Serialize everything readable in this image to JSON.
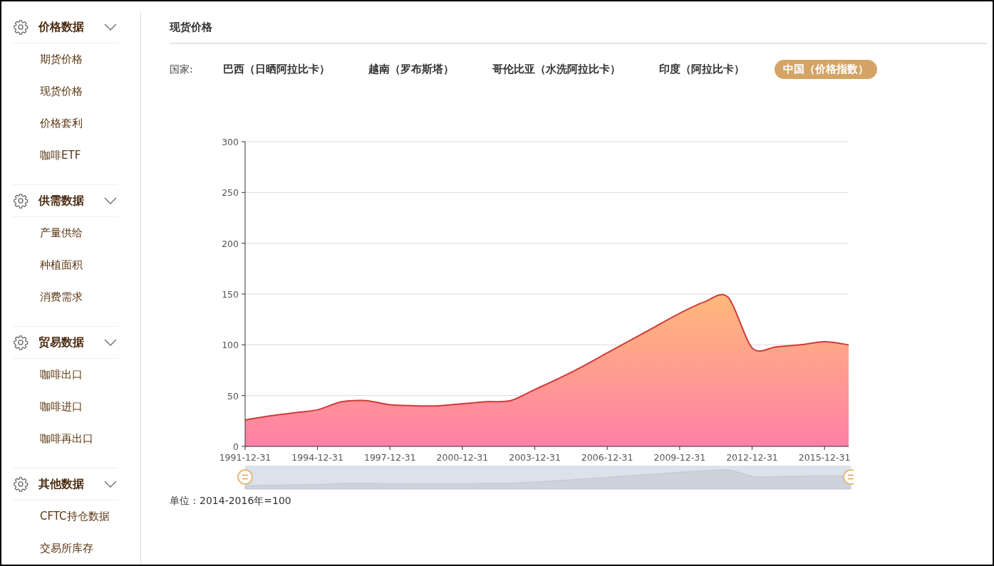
{
  "sidebar": {
    "sections": [
      {
        "title": "价格数据",
        "items": [
          "期货价格",
          "现货价格",
          "价格套利",
          "咖啡ETF"
        ]
      },
      {
        "title": "供需数据",
        "items": [
          "产量供给",
          "种植面积",
          "消费需求"
        ]
      },
      {
        "title": "贸易数据",
        "items": [
          "咖啡出口",
          "咖啡进口",
          "咖啡再出口"
        ]
      },
      {
        "title": "其他数据",
        "items": [
          "CFTC持仓数据",
          "交易所库存"
        ]
      }
    ]
  },
  "main": {
    "title": "现货价格",
    "country_label": "国家:",
    "countries": [
      {
        "label": "巴西（日晒阿拉比卡）",
        "selected": false
      },
      {
        "label": "越南（罗布斯塔）",
        "selected": false
      },
      {
        "label": "哥伦比亚（水洗阿拉比卡）",
        "selected": false
      },
      {
        "label": "印度（阿拉比卡）",
        "selected": false
      },
      {
        "label": "中国（价格指数）",
        "selected": true
      }
    ],
    "chart_data": {
      "type": "area",
      "categories": [
        "1991-12-31",
        null,
        null,
        "1994-12-31",
        null,
        null,
        "1997-12-31",
        null,
        null,
        "2000-12-31",
        null,
        null,
        "2003-12-31",
        null,
        null,
        "2006-12-31",
        null,
        null,
        "2009-12-31",
        null,
        null,
        "2012-12-31",
        null,
        null,
        "2015-12-31",
        null
      ],
      "series": [
        {
          "color": "#d13a3a",
          "values": [
            26,
            30,
            33,
            36,
            44,
            45,
            41,
            40,
            40,
            42,
            44,
            45,
            56,
            67,
            79,
            92,
            105,
            118,
            131,
            142,
            147,
            97,
            98,
            100,
            103,
            100
          ]
        }
      ],
      "grid": true,
      "ylim": [
        0,
        300
      ],
      "yticks": [
        0,
        50,
        100,
        150,
        200,
        250,
        300
      ]
    },
    "unit_note": "单位：2014-2016年=100"
  }
}
